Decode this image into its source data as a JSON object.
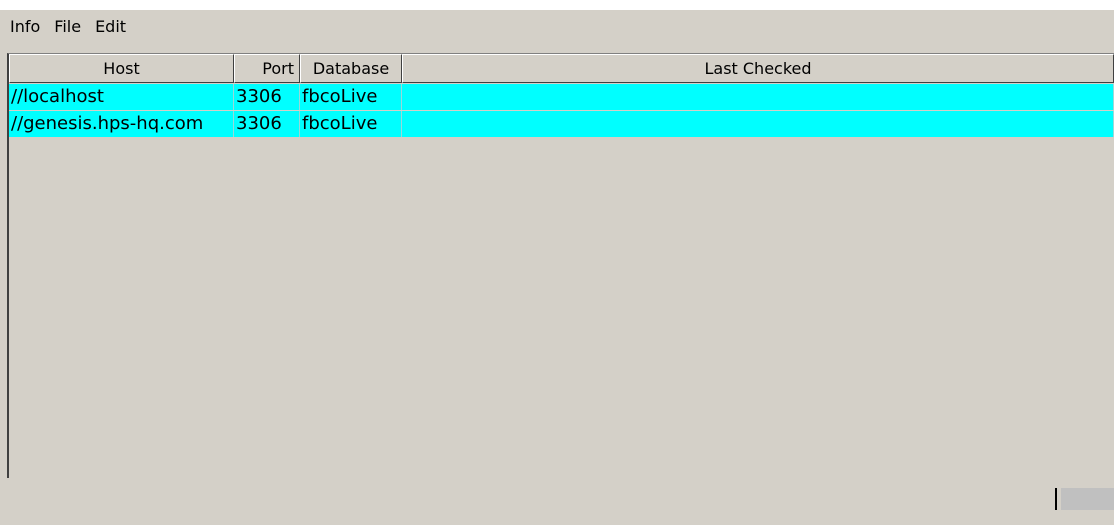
{
  "menu": {
    "items": [
      {
        "label": "Info"
      },
      {
        "label": "File"
      },
      {
        "label": "Edit"
      }
    ]
  },
  "table": {
    "columns": [
      "Host",
      "Port",
      "Database",
      "Last Checked"
    ],
    "rows": [
      {
        "host": "//localhost",
        "port": "3306",
        "database": "fbcoLive",
        "last_checked": ""
      },
      {
        "host": "//genesis.hps-hq.com",
        "port": "3306",
        "database": "fbcoLive",
        "last_checked": ""
      }
    ],
    "selection_color": "#00ffff"
  }
}
